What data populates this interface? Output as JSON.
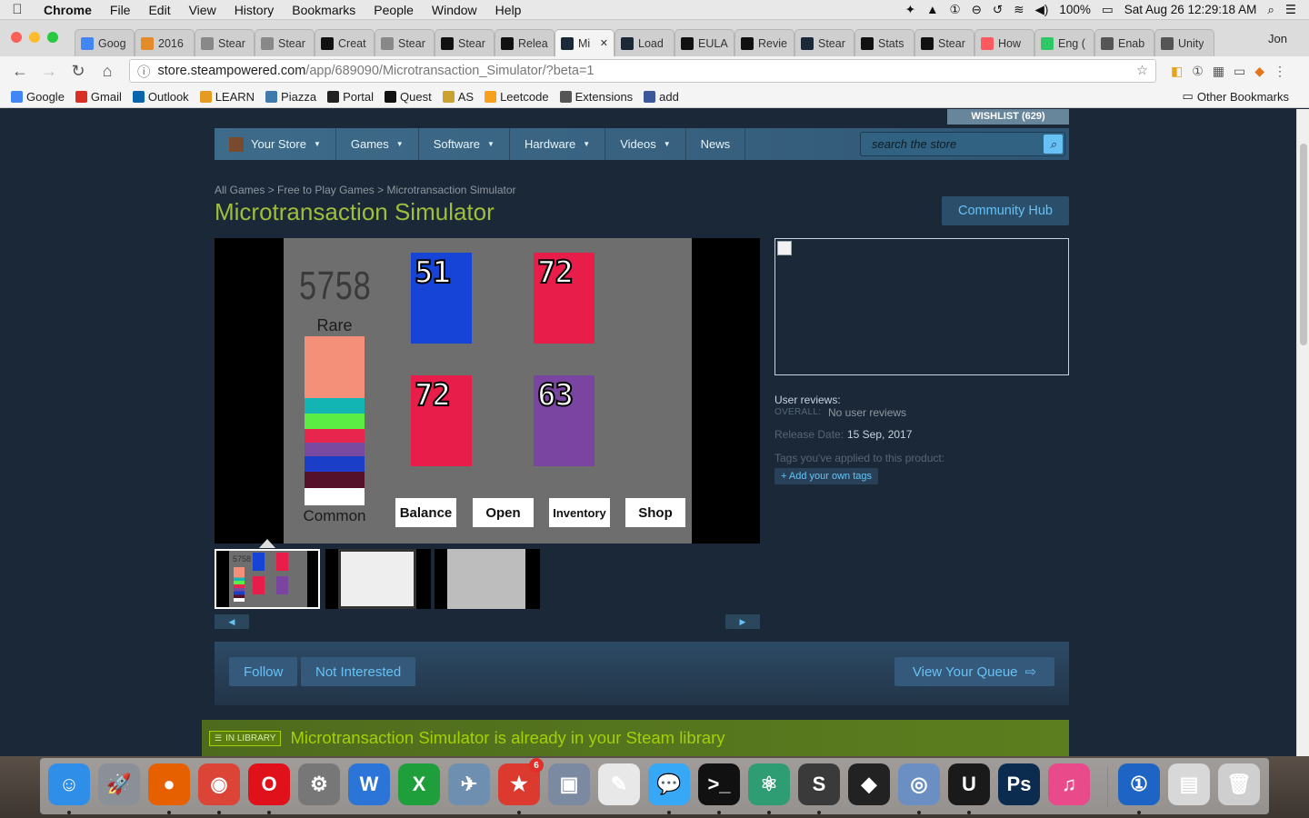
{
  "menubar": {
    "app_name": "Chrome",
    "items": [
      "File",
      "Edit",
      "View",
      "History",
      "Bookmarks",
      "People",
      "Window",
      "Help"
    ],
    "battery": "100%",
    "clock": "Sat Aug 26  12:29:18 AM"
  },
  "tabs": [
    {
      "label": "Goog",
      "icon": "google-icon",
      "color": "#4285f4"
    },
    {
      "label": "2016",
      "icon": "uiuc-icon",
      "color": "#e48a2a"
    },
    {
      "label": "Stear",
      "icon": "page-icon",
      "color": "#888888"
    },
    {
      "label": "Stear",
      "icon": "page-icon",
      "color": "#888888"
    },
    {
      "label": "Creat",
      "icon": "steam-dev-icon",
      "color": "#111111"
    },
    {
      "label": "Stear",
      "icon": "page-icon",
      "color": "#888888"
    },
    {
      "label": "Stear",
      "icon": "steam-dev-icon",
      "color": "#111111"
    },
    {
      "label": "Relea",
      "icon": "steam-dev-icon",
      "color": "#111111"
    },
    {
      "label": "Mi",
      "icon": "steam-icon",
      "color": "#1b2838",
      "active": true
    },
    {
      "label": "Load",
      "icon": "steam-icon",
      "color": "#1b2838"
    },
    {
      "label": "EULA",
      "icon": "steam-dev-icon",
      "color": "#111111"
    },
    {
      "label": "Revie",
      "icon": "steam-dev-icon",
      "color": "#111111"
    },
    {
      "label": "Stear",
      "icon": "steam-icon",
      "color": "#1b2838"
    },
    {
      "label": "Stats",
      "icon": "steam-dev-icon",
      "color": "#111111"
    },
    {
      "label": "Stear",
      "icon": "steam-dev-icon",
      "color": "#111111"
    },
    {
      "label": "How",
      "icon": "airbnb-icon",
      "color": "#ff5a5f"
    },
    {
      "label": "Eng (",
      "icon": "hint-icon",
      "color": "#2ec866"
    },
    {
      "label": "Enab",
      "icon": "vscode-icon",
      "color": "#555555"
    },
    {
      "label": "Unity",
      "icon": "vscode-icon",
      "color": "#555555"
    }
  ],
  "profile_name": "Jon",
  "omnibox": {
    "host": "store.steampowered.com",
    "path": "/app/689090/Microtransaction_Simulator/?beta=1"
  },
  "bookmarks": [
    {
      "label": "Google",
      "color": "#4285f4"
    },
    {
      "label": "Gmail",
      "color": "#d93025"
    },
    {
      "label": "Outlook",
      "color": "#0a64ad"
    },
    {
      "label": "LEARN",
      "color": "#e59b22"
    },
    {
      "label": "Piazza",
      "color": "#3e7aab"
    },
    {
      "label": "Portal",
      "color": "#222222"
    },
    {
      "label": "Quest",
      "color": "#111111"
    },
    {
      "label": "AS",
      "color": "#caa22f"
    },
    {
      "label": "Leetcode",
      "color": "#f89f1b"
    },
    {
      "label": "Extensions",
      "color": "#555555"
    },
    {
      "label": "add",
      "color": "#3b5998"
    }
  ],
  "other_bookmarks": "Other Bookmarks",
  "steam": {
    "wishlist": "WISHLIST (629)",
    "nav": [
      "Your Store",
      "Games",
      "Software",
      "Hardware",
      "Videos",
      "News"
    ],
    "search_placeholder": "search the store",
    "breadcrumbs": [
      "All Games",
      "Free to Play Games",
      "Microtransaction Simulator"
    ],
    "title": "Microtransaction Simulator",
    "community_hub": "Community Hub",
    "game": {
      "number": "5758",
      "rare_label": "Rare",
      "common_label": "Common",
      "rarity_colors": [
        "#f4907a",
        "#f4907a",
        "#12b4b4",
        "#5ced44",
        "#e8254d",
        "#7a4aa0",
        "#1a3ec8",
        "#55102a",
        "#ffffff"
      ],
      "cards": [
        {
          "value": "51",
          "color": "#1644d6"
        },
        {
          "value": "72",
          "color": "#e81d4a"
        },
        {
          "value": "72",
          "color": "#e81d4a"
        },
        {
          "value": "63",
          "color": "#7a45a0"
        }
      ],
      "buttons": [
        "Balance",
        "Open",
        "Inventory",
        "Shop"
      ]
    },
    "reviews_label": "User reviews:",
    "overall_label": "OVERALL:",
    "overall_value": "No user reviews",
    "release_label": "Release Date:",
    "release_value": "15 Sep, 2017",
    "tags_label": "Tags you've applied to this product:",
    "add_tags": "+ Add your own tags",
    "follow": "Follow",
    "not_interested": "Not Interested",
    "view_queue": "View Your Queue",
    "in_library_badge": "IN LIBRARY",
    "library_text": "Microtransaction Simulator is already in your Steam library"
  },
  "dock": [
    {
      "name": "finder-icon",
      "glyph": "☺",
      "color": "#2f8ee8"
    },
    {
      "name": "launchpad-icon",
      "glyph": "🚀",
      "color": "#8a8f98"
    },
    {
      "name": "firefox-icon",
      "glyph": "●",
      "color": "#e66000"
    },
    {
      "name": "chrome-icon",
      "glyph": "◉",
      "color": "#db4437"
    },
    {
      "name": "opera-icon",
      "glyph": "O",
      "color": "#e0111b"
    },
    {
      "name": "system-preferences-icon",
      "glyph": "⚙",
      "color": "#777777"
    },
    {
      "name": "word-icon",
      "glyph": "W",
      "color": "#2b75d8"
    },
    {
      "name": "excel-icon",
      "glyph": "X",
      "color": "#1f9e3c"
    },
    {
      "name": "preview-icon",
      "glyph": "✈",
      "color": "#6e8fb0"
    },
    {
      "name": "wunderlist-icon",
      "glyph": "★",
      "color": "#dc3a2f"
    },
    {
      "name": "image-capture-icon",
      "glyph": "▣",
      "color": "#7b8aa0"
    },
    {
      "name": "textedit-icon",
      "glyph": "✎",
      "color": "#e8e8e8"
    },
    {
      "name": "messages-icon",
      "glyph": "💬",
      "color": "#36a8f5"
    },
    {
      "name": "terminal-icon",
      "glyph": ">_",
      "color": "#111111"
    },
    {
      "name": "atom-icon",
      "glyph": "⚛",
      "color": "#2f9d74"
    },
    {
      "name": "sublime-icon",
      "glyph": "S",
      "color": "#3a3a3a"
    },
    {
      "name": "unity-icon",
      "glyph": "◆",
      "color": "#222222"
    },
    {
      "name": "remote-icon",
      "glyph": "◎",
      "color": "#6c8fc3"
    },
    {
      "name": "unreal-icon",
      "glyph": "U",
      "color": "#1a1a1a"
    },
    {
      "name": "photoshop-icon",
      "glyph": "Ps",
      "color": "#0b2b4f"
    },
    {
      "name": "itunes-icon",
      "glyph": "♫",
      "color": "#e84a8a"
    },
    {
      "name": "1password-icon",
      "glyph": "①",
      "color": "#1d64c4"
    },
    {
      "name": "archive-icon",
      "glyph": "▤",
      "color": "#d8d8d8"
    },
    {
      "name": "trash-icon",
      "glyph": "🗑",
      "color": "#cfcfcf"
    }
  ],
  "dock_badge": "6"
}
